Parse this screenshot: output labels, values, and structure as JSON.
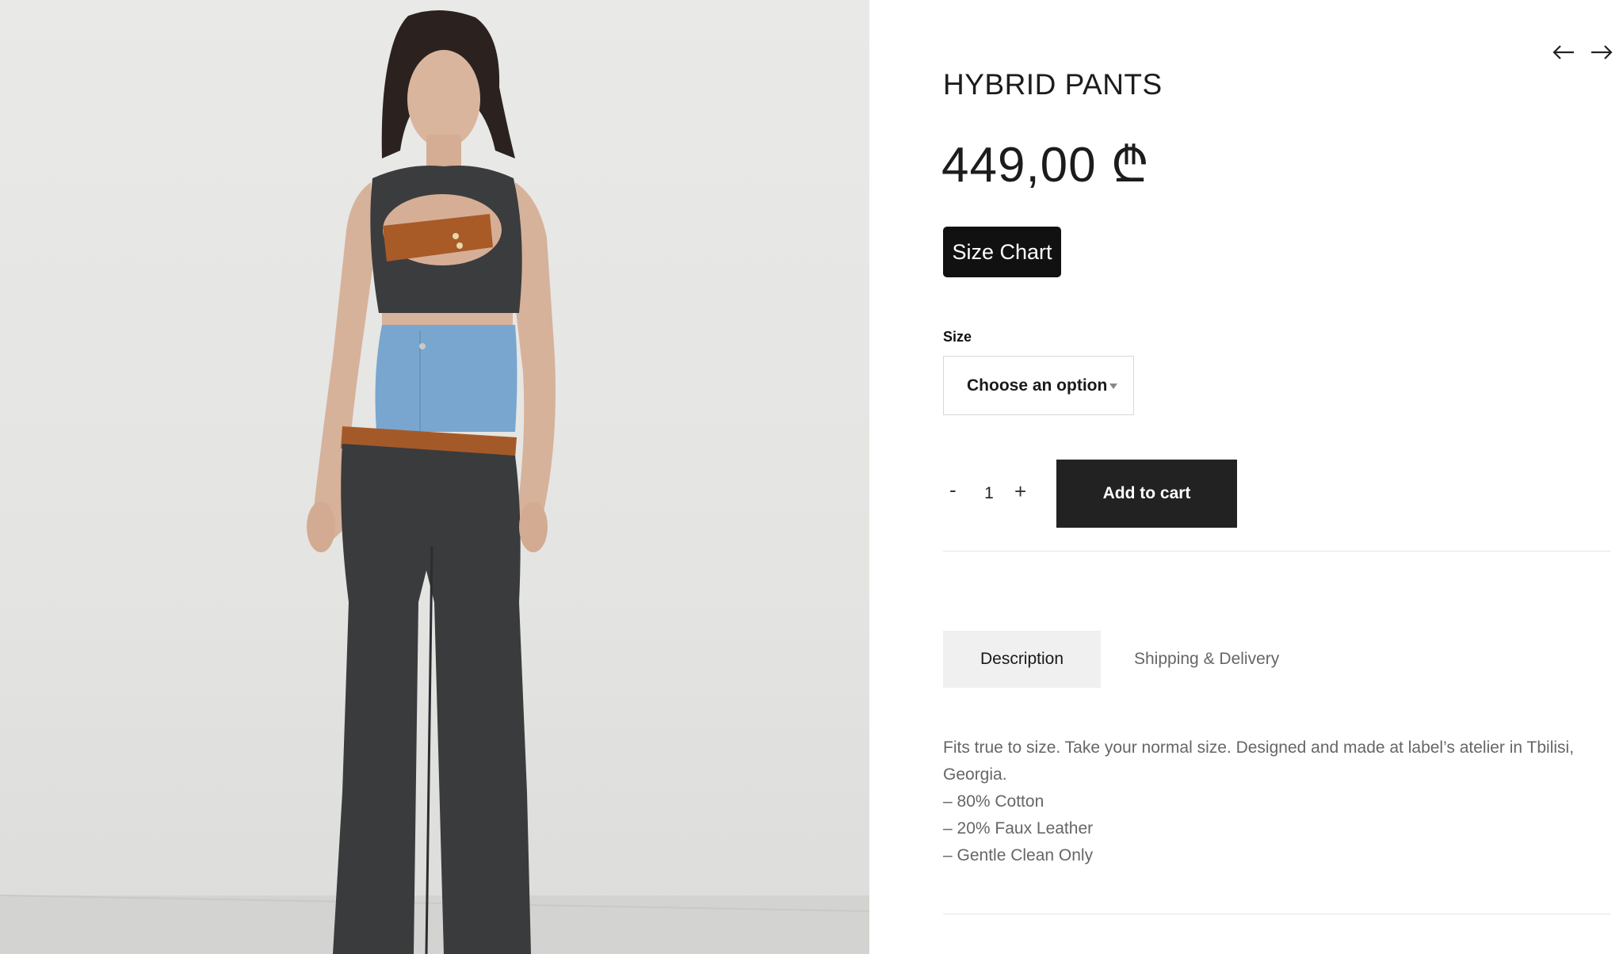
{
  "product": {
    "title": "HYBRID PANTS",
    "price": "449,00 ₾",
    "image_alt": "Model wearing hybrid pants"
  },
  "navigation": {
    "prev_icon": "arrow-left-icon",
    "next_icon": "arrow-right-icon"
  },
  "size_chart": {
    "label": "Size Chart"
  },
  "variation": {
    "label": "Size",
    "selected": "Choose an option"
  },
  "cart": {
    "minus_label": "-",
    "quantity": "1",
    "plus_label": "+",
    "add_label": "Add to cart"
  },
  "tabs": [
    {
      "label": "Description",
      "active": true
    },
    {
      "label": "Shipping & Delivery",
      "active": false
    }
  ],
  "description": {
    "lines": [
      "Fits true to size. Take your normal size. Designed and made at label’s atelier in Tbilisi, Georgia.",
      "– 80% Cotton",
      "– 20% Faux Leather",
      "– Gentle Clean Only"
    ]
  },
  "colors": {
    "button_dark": "#111111",
    "add_to_cart": "#222222",
    "active_tab": "#f0f0f0",
    "background_wall": "#e7e7e5"
  }
}
